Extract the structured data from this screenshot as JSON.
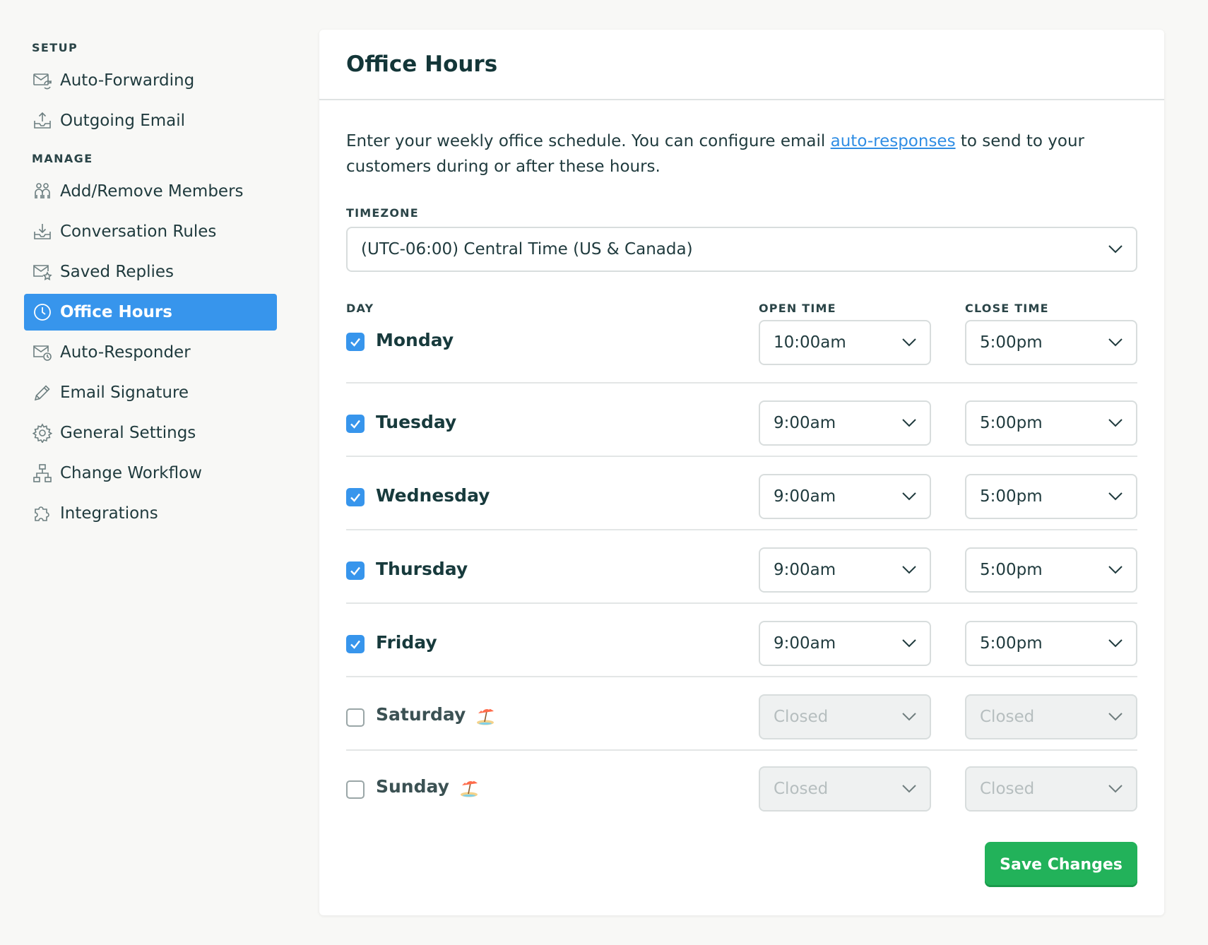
{
  "sidebar": {
    "setup_label": "SETUP",
    "manage_label": "MANAGE",
    "setup_items": [
      {
        "label": "Auto-Forwarding",
        "icon": "mail-forward-icon"
      },
      {
        "label": "Outgoing Email",
        "icon": "outbox-upload-icon"
      }
    ],
    "manage_items": [
      {
        "label": "Add/Remove Members",
        "icon": "members-icon"
      },
      {
        "label": "Conversation Rules",
        "icon": "inbox-download-icon"
      },
      {
        "label": "Saved Replies",
        "icon": "mail-star-icon"
      },
      {
        "label": "Office Hours",
        "icon": "clock-icon",
        "active": true
      },
      {
        "label": "Auto-Responder",
        "icon": "mail-clock-icon"
      },
      {
        "label": "Email Signature",
        "icon": "pencil-icon"
      },
      {
        "label": "General Settings",
        "icon": "gear-icon"
      },
      {
        "label": "Change Workflow",
        "icon": "workflow-icon"
      },
      {
        "label": "Integrations",
        "icon": "puzzle-icon"
      }
    ]
  },
  "page": {
    "title": "Office Hours",
    "intro_before": "Enter your weekly office schedule. You can configure email ",
    "intro_link": "auto-responses",
    "intro_after": " to send to your customers during or after these hours."
  },
  "timezone": {
    "label": "TIMEZONE",
    "value": "(UTC-06:00) Central Time (US & Canada)"
  },
  "schedule": {
    "day_header": "DAY",
    "open_header": "OPEN TIME",
    "close_header": "CLOSE TIME",
    "days": [
      {
        "name": "Monday",
        "checked": true,
        "open": "10:00am",
        "close": "5:00pm"
      },
      {
        "name": "Tuesday",
        "checked": true,
        "open": "9:00am",
        "close": "5:00pm"
      },
      {
        "name": "Wednesday",
        "checked": true,
        "open": "9:00am",
        "close": "5:00pm"
      },
      {
        "name": "Thursday",
        "checked": true,
        "open": "9:00am",
        "close": "5:00pm"
      },
      {
        "name": "Friday",
        "checked": true,
        "open": "9:00am",
        "close": "5:00pm"
      },
      {
        "name": "Saturday",
        "checked": false,
        "open": "Closed",
        "close": "Closed",
        "icon": "beach-umbrella-icon"
      },
      {
        "name": "Sunday",
        "checked": false,
        "open": "Closed",
        "close": "Closed",
        "icon": "beach-umbrella-icon"
      }
    ]
  },
  "actions": {
    "save_label": "Save Changes"
  },
  "colors": {
    "accent": "#3795ec",
    "save": "#22b25a",
    "link": "#2f8de4",
    "text": "#1f3a3d"
  }
}
